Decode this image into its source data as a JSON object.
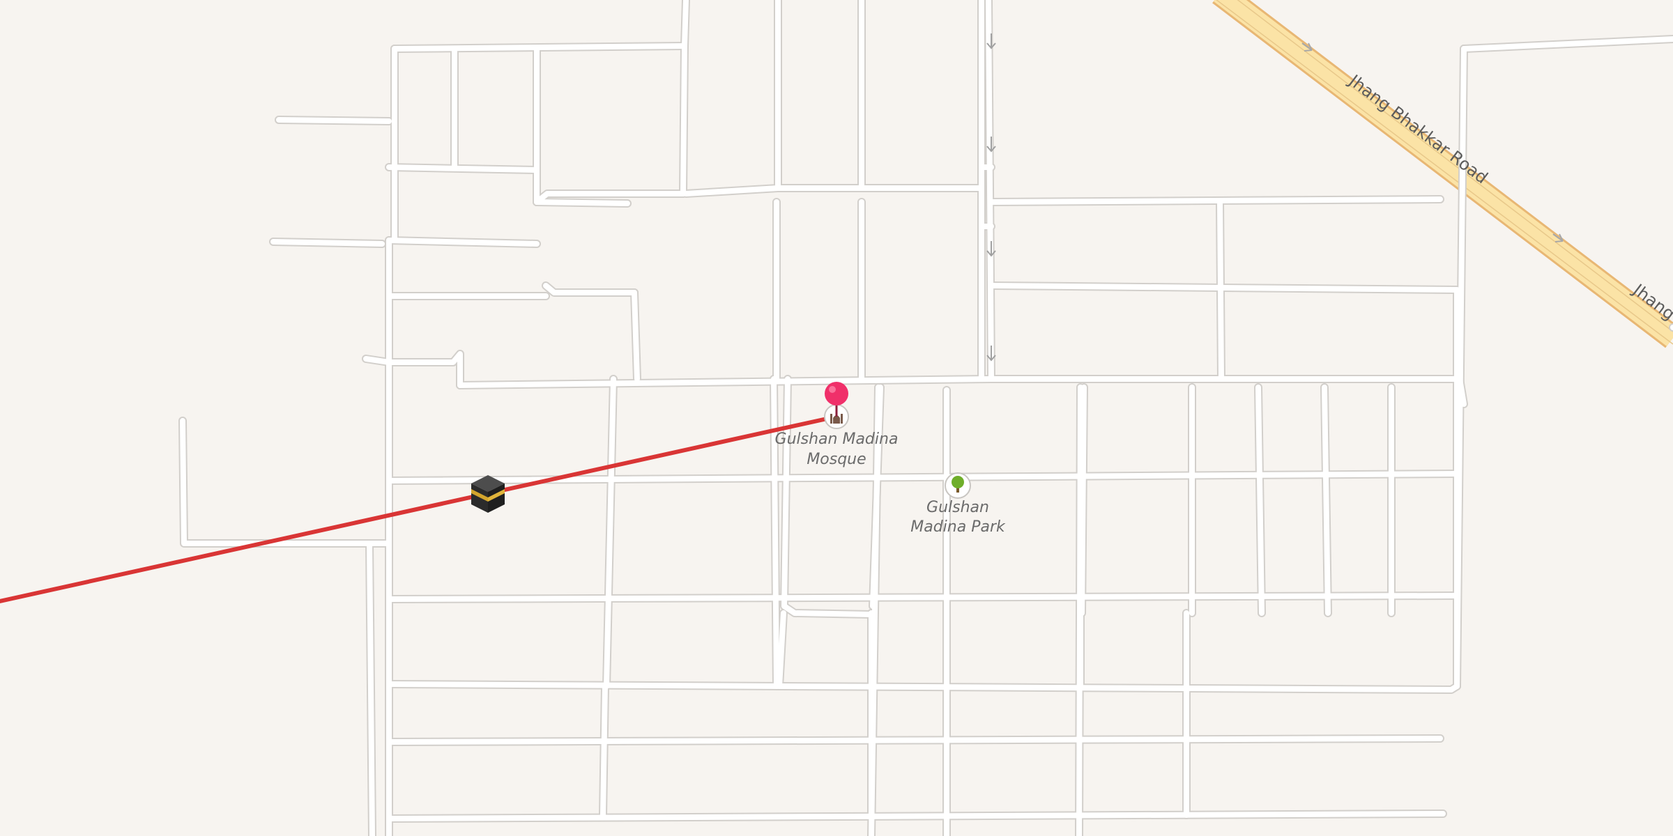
{
  "map": {
    "colors": {
      "background": "#f7f4f0",
      "street_fill": "#ffffff",
      "street_casing": "#d2cfcb",
      "highway_fill": "#fbe3a6",
      "highway_casing": "#e8b774",
      "route_line": "#d93535",
      "pin": "#f0306a"
    },
    "roads": [
      {
        "name": "Jhang Bhakkar Road",
        "type": "primary",
        "labels": [
          "Jhang Bhakkar Road",
          "Jhang"
        ]
      }
    ],
    "pois": [
      {
        "id": "mosque",
        "icon": "mosque-icon",
        "label_lines": [
          "Gulshan Madina",
          "Mosque"
        ]
      },
      {
        "id": "park",
        "icon": "tree-icon",
        "label_lines": [
          "Gulshan",
          "Madina Park"
        ]
      }
    ],
    "markers": [
      {
        "id": "location-pin",
        "icon": "map-pin-icon",
        "color": "#f0306a"
      },
      {
        "id": "kaaba",
        "icon": "kaaba-icon"
      }
    ],
    "route": {
      "type": "qibla-direction-line",
      "color": "#d93535"
    }
  }
}
